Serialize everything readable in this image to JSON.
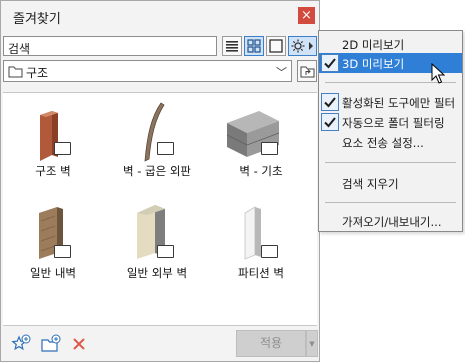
{
  "palette": {
    "title": "즐겨찾기",
    "close_glyph": "×",
    "search_value": "검색",
    "folder_name": "구조",
    "view_buttons": [
      "list-view-icon",
      "grid-view-icon",
      "large-preview-icon",
      "gear-icon"
    ],
    "items": [
      {
        "label": "구조 벽",
        "icon": "structural-wall-icon"
      },
      {
        "label": "벽 - 굽은 외판",
        "icon": "curved-wall-icon"
      },
      {
        "label": "벽 - 기초",
        "icon": "foundation-wall-icon"
      },
      {
        "label": "일반 내벽",
        "icon": "interior-wall-icon"
      },
      {
        "label": "일반 외부 벽",
        "icon": "exterior-wall-icon"
      },
      {
        "label": "파티션 벽",
        "icon": "partition-wall-icon"
      }
    ],
    "apply_label": "적용",
    "accent_color": "#2f7fd6",
    "close_color": "#d34a3f"
  },
  "menu": {
    "items": [
      {
        "label": "2D 미리보기",
        "checked": false,
        "highlighted": false
      },
      {
        "label": "3D 미리보기",
        "checked": true,
        "highlighted": true
      },
      {
        "label": "활성화된 도구에만 필터",
        "checked": true,
        "highlighted": false
      },
      {
        "label": "자동으로 폴더 필터링",
        "checked": true,
        "highlighted": false
      },
      {
        "label": "요소 전송 설정...",
        "checked": false,
        "highlighted": false
      },
      {
        "label": "검색 지우기",
        "checked": false,
        "highlighted": false
      },
      {
        "label": "가져오기/내보내기...",
        "checked": false,
        "highlighted": false
      }
    ]
  }
}
